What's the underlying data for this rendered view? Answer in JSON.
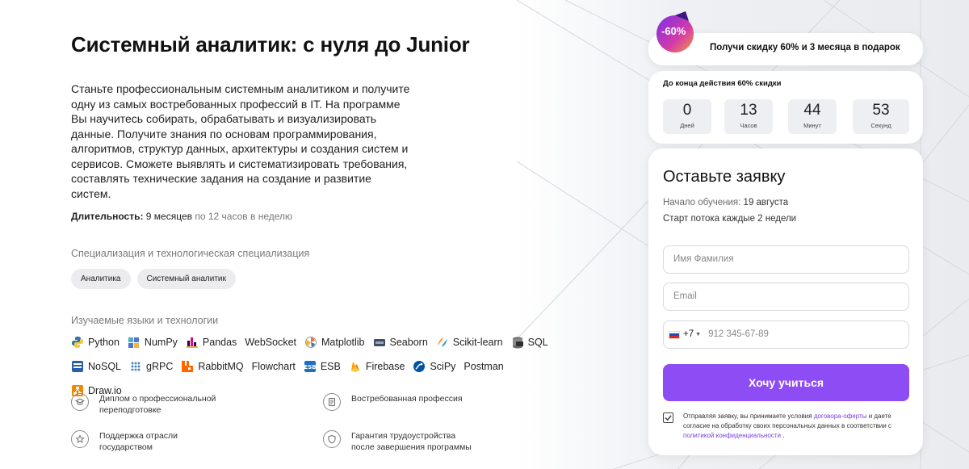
{
  "left": {
    "title": "Системный аналитик: с нуля до Junior",
    "description": "Станьте профессиональным системным аналитиком и получите одну из самых востребованных профессий в IT. На программе Вы научитесь собирать, обрабатывать и визуализировать данные. Получите знания по основам программирования, алгоритмов, структур данных, архитектуры и создания систем и сервисов. Сможете выявлять и систематизировать требования, составлять технические задания на создание и развитие систем.",
    "duration_label": "Длительность:",
    "duration_value": "9 месяцев",
    "duration_suffix": "по 12 часов в неделю",
    "spec_label": "Специализация и технологическая специализация",
    "chips": [
      "Аналитика",
      "Системный аналитик"
    ],
    "tech_label": "Изучаемые языки и технологии",
    "tech": [
      {
        "label": "Python",
        "icon": "python-icon"
      },
      {
        "label": "NumPy",
        "icon": "numpy-icon"
      },
      {
        "label": "Pandas",
        "icon": "pandas-icon"
      },
      {
        "label": "WebSocket",
        "icon": "none"
      },
      {
        "label": "Matplotlib",
        "icon": "matplotlib-icon"
      },
      {
        "label": "Seaborn",
        "icon": "seaborn-icon"
      },
      {
        "label": "Scikit-learn",
        "icon": "scikit-learn-icon"
      },
      {
        "label": "SQL",
        "icon": "sql-icon"
      },
      {
        "label": "NoSQL",
        "icon": "nosql-icon"
      },
      {
        "label": "gRPC",
        "icon": "grpc-icon"
      },
      {
        "label": "RabbitMQ",
        "icon": "rabbitmq-icon"
      },
      {
        "label": "Flowchart",
        "icon": "none"
      },
      {
        "label": "ESB",
        "icon": "esb-icon"
      },
      {
        "label": "Firebase",
        "icon": "firebase-icon"
      },
      {
        "label": "SciPy",
        "icon": "scipy-icon"
      },
      {
        "label": "Postman",
        "icon": "none"
      },
      {
        "label": "Draw.io",
        "icon": "drawio-icon"
      }
    ]
  },
  "features": [
    {
      "text": "Диплом о профессиональной переподготовке",
      "icon": "graduation-cap-icon"
    },
    {
      "text": "Востребованная профессия",
      "icon": "document-icon"
    },
    {
      "text": "Поддержка отрасли государством",
      "icon": "star-icon"
    },
    {
      "text": "Гарантия трудоустройства после завершения программы",
      "icon": "shield-icon"
    }
  ],
  "promo": {
    "badge": "-60%",
    "text": "Получи скидку 60% и 3 месяца в подарок"
  },
  "timer": {
    "label": "До конца действия 60% скидки",
    "units": [
      {
        "value": "0",
        "unit": "Дней"
      },
      {
        "value": "13",
        "unit": "Часов"
      },
      {
        "value": "44",
        "unit": "Минут"
      },
      {
        "value": "53",
        "unit": "Секунд"
      }
    ]
  },
  "form": {
    "title": "Оставьте заявку",
    "start_label": "Начало обучения:",
    "start_value": "19 августа",
    "stream": "Старт потока каждые 2 недели",
    "name_placeholder": "Имя Фамилия",
    "email_placeholder": "Email",
    "phone_code": "+7",
    "phone_placeholder": "912 345-67-89",
    "submit": "Хочу учиться",
    "consent_1": "Отправляя заявку, вы принимаете условия ",
    "consent_link_1": "договора-оферты",
    "consent_2": " и даете согласие на обработку своих персональных данных в соответствии с ",
    "consent_link_2": "политикой конфиденциальности",
    "consent_3": " ."
  },
  "colors": {
    "accent": "#8e4cf5",
    "link": "#7a3ee0"
  }
}
